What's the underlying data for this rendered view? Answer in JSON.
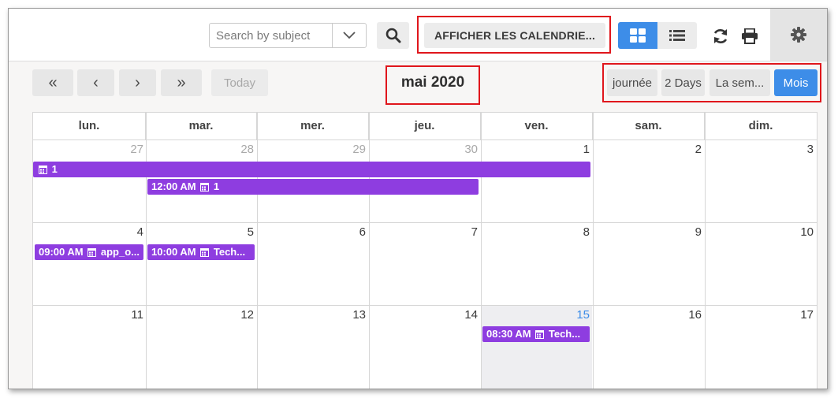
{
  "toolbar": {
    "search_placeholder": "Search by subject",
    "calendars_button": "AFFICHER LES CALENDRIE...",
    "icons": {
      "search": "search-icon",
      "dropdown": "chevron-down-icon",
      "grid_view": "grid-icon",
      "list_view": "list-icon",
      "refresh": "refresh-icon",
      "print": "print-icon",
      "settings": "gear-icon"
    },
    "active_view": "grid"
  },
  "navigation": {
    "first_label": "«",
    "prev_label": "‹",
    "next_label": "›",
    "last_label": "»",
    "today_label": "Today",
    "title": "mai 2020"
  },
  "ranges": {
    "day": "journée",
    "two_days": "2 Days",
    "week": "La sem...",
    "month": "Mois",
    "active": "Mois"
  },
  "weekdays": [
    "lun.",
    "mar.",
    "mer.",
    "jeu.",
    "ven.",
    "sam.",
    "dim."
  ],
  "weeks": [
    {
      "days": [
        "27",
        "28",
        "29",
        "30",
        "1",
        "2",
        "3"
      ]
    },
    {
      "days": [
        "4",
        "5",
        "6",
        "7",
        "8",
        "9",
        "10"
      ]
    },
    {
      "days": [
        "11",
        "12",
        "13",
        "14",
        "15",
        "16",
        "17"
      ]
    }
  ],
  "today": "15",
  "events": [
    {
      "label": "1",
      "time": ""
    },
    {
      "label": "1",
      "time": "12:00 AM"
    },
    {
      "label": "app_o...",
      "time": "09:00 AM"
    },
    {
      "label": "Tech...",
      "time": "10:00 AM"
    },
    {
      "label": "Tech...",
      "time": "08:30 AM"
    }
  ],
  "colors": {
    "accent": "#3d8de8",
    "event": "#8e3de0",
    "highlight": "#e0161c"
  }
}
